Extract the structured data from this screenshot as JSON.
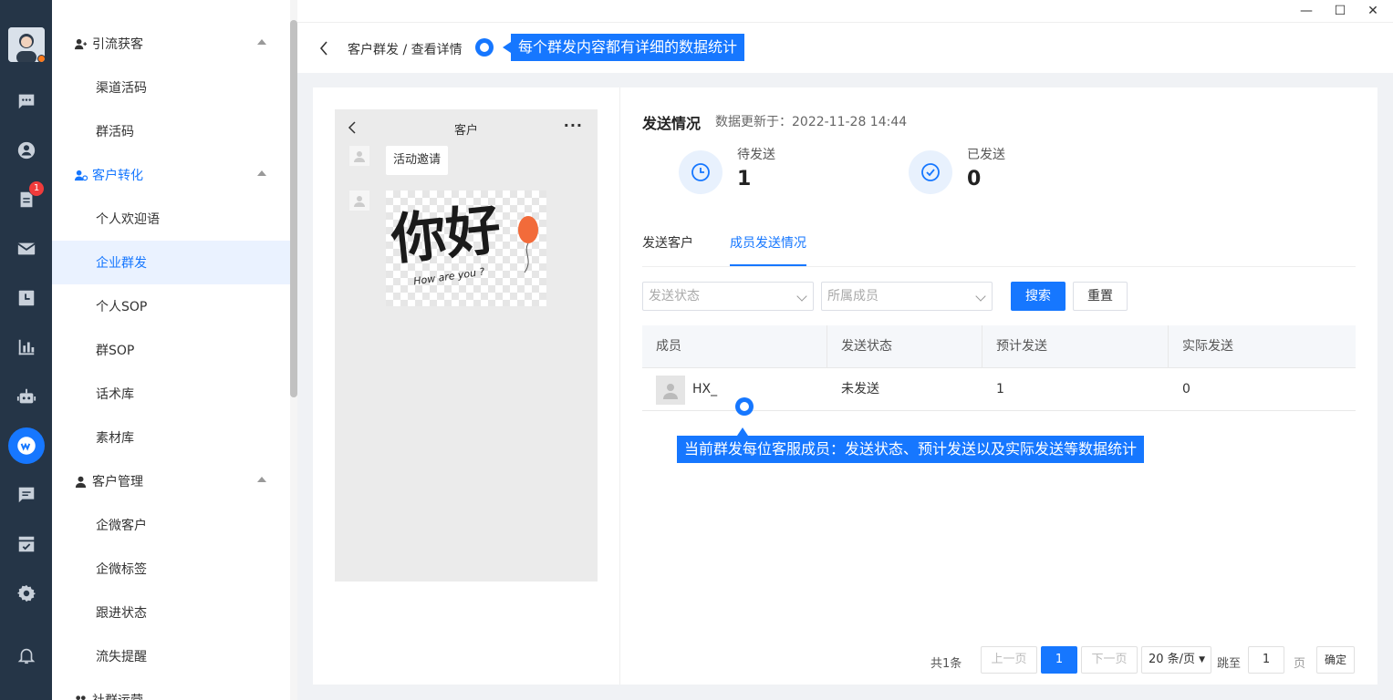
{
  "window": {
    "minimize": "—",
    "maximize": "☐",
    "close": "✕"
  },
  "rail": {
    "notification_badge": "1"
  },
  "menu": {
    "groups": [
      {
        "label": "引流获客"
      },
      {
        "label": "客户转化"
      },
      {
        "label": "客户管理"
      },
      {
        "label": "社群运营"
      }
    ],
    "items": [
      "渠道活码",
      "群活码",
      "个人欢迎语",
      "企业群发",
      "个人SOP",
      "群SOP",
      "话术库",
      "素材库",
      "企微客户",
      "企微标签",
      "跟进状态",
      "流失提醒"
    ]
  },
  "header": {
    "breadcrumb": "客户群发 / 查看详情"
  },
  "annotations": {
    "top": "每个群发内容都有详细的数据统计",
    "table": "当前群发每位客服成员：发送状态、预计发送以及实际发送等数据统计"
  },
  "phone": {
    "title": "客户",
    "more": "···",
    "message": "活动邀请",
    "image_text_main": "你好",
    "image_text_sub": "How are you ?"
  },
  "send_status": {
    "title": "发送情况",
    "updated": "数据更新于：2022-11-28 14:44",
    "pending_label": "待发送",
    "pending_value": "1",
    "sent_label": "已发送",
    "sent_value": "0"
  },
  "tabs": [
    "发送客户",
    "成员发送情况"
  ],
  "filters": {
    "status_placeholder": "发送状态",
    "member_placeholder": "所属成员",
    "search": "搜索",
    "reset": "重置"
  },
  "table": {
    "columns": [
      "成员",
      "发送状态",
      "预计发送",
      "实际发送"
    ],
    "rows": [
      {
        "member": "HX_",
        "status": "未发送",
        "expected": "1",
        "actual": "0"
      }
    ]
  },
  "pagination": {
    "total": "共1条",
    "prev": "上一页",
    "current": "1",
    "next": "下一页",
    "page_size": "20 条/页",
    "jump_label": "跳至",
    "jump_value": "1",
    "page_unit": "页",
    "confirm": "确定"
  },
  "colors": {
    "accent": "#1677ff",
    "rail": "#253547"
  }
}
